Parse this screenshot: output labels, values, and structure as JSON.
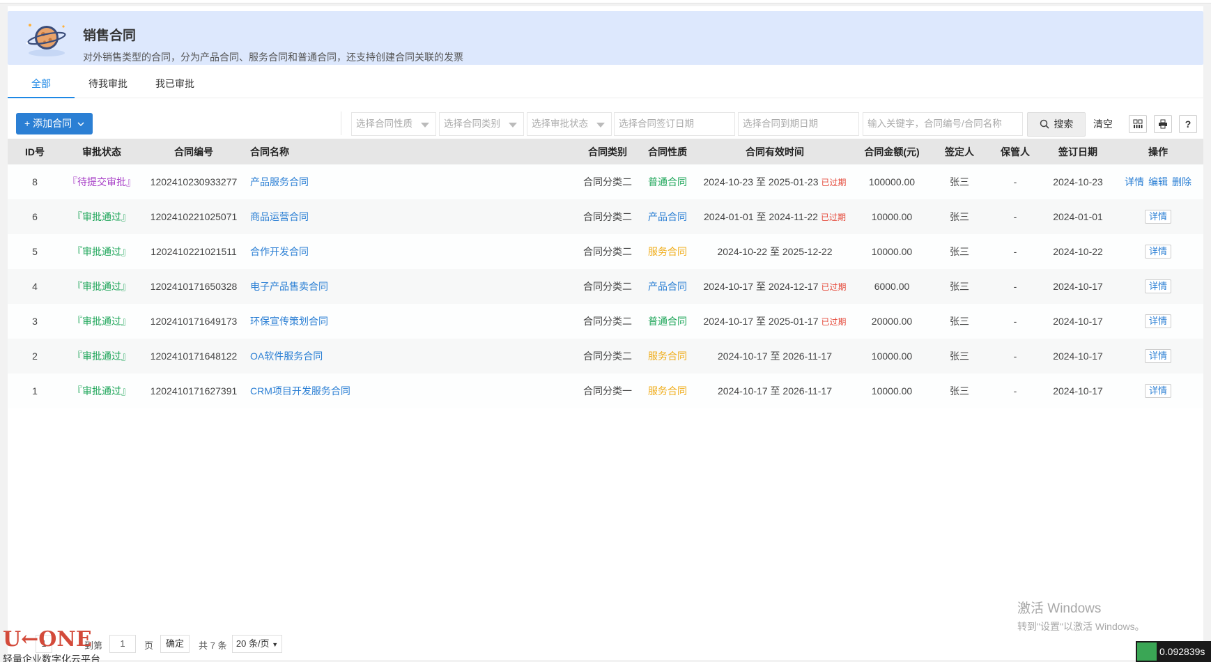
{
  "banner": {
    "title": "销售合同",
    "description": "对外销售类型的合同，分为产品合同、服务合同和普通合同，还支持创建合同关联的发票"
  },
  "tabs": [
    "全部",
    "待我审批",
    "我已审批"
  ],
  "toolbar": {
    "add_label": "+ 添加合同",
    "nature_placeholder": "选择合同性质",
    "category_placeholder": "选择合同类别",
    "status_placeholder": "选择审批状态",
    "sign_date_placeholder": "选择合同签订日期",
    "expire_date_placeholder": "选择合同到期日期",
    "keyword_placeholder": "输入关键字，合同编号/合同名称",
    "search_label": "搜索",
    "clear_label": "清空",
    "help_label": "?"
  },
  "table": {
    "headers": [
      "ID号",
      "审批状态",
      "合同编号",
      "合同名称",
      "合同类别",
      "合同性质",
      "合同有效时间",
      "合同金额(元)",
      "签定人",
      "保管人",
      "签订日期",
      "操作"
    ],
    "rows": [
      {
        "id": "8",
        "status": "『待提交审批』",
        "status_type": "pending",
        "code": "1202410230933277",
        "name": "产品服务合同",
        "category": "合同分类二",
        "nature": "普通合同",
        "nature_type": "normal",
        "period": "2024-10-23 至 2025-01-23",
        "expired": "已过期",
        "amount": "100000.00",
        "signer": "张三",
        "keeper": "-",
        "sign_date": "2024-10-23",
        "ops": [
          "详情",
          "编辑",
          "删除"
        ]
      },
      {
        "id": "6",
        "status": "『审批通过』",
        "status_type": "pass",
        "code": "1202410221025071",
        "name": "商品运营合同",
        "category": "合同分类二",
        "nature": "产品合同",
        "nature_type": "product",
        "period": "2024-01-01 至 2024-11-22",
        "expired": "已过期",
        "amount": "10000.00",
        "signer": "张三",
        "keeper": "-",
        "sign_date": "2024-01-01",
        "ops": [
          "详情"
        ]
      },
      {
        "id": "5",
        "status": "『审批通过』",
        "status_type": "pass",
        "code": "1202410221021511",
        "name": "合作开发合同",
        "category": "合同分类二",
        "nature": "服务合同",
        "nature_type": "service",
        "period": "2024-10-22 至 2025-12-22",
        "expired": "",
        "amount": "10000.00",
        "signer": "张三",
        "keeper": "-",
        "sign_date": "2024-10-22",
        "ops": [
          "详情"
        ]
      },
      {
        "id": "4",
        "status": "『审批通过』",
        "status_type": "pass",
        "code": "1202410171650328",
        "name": "电子产品售卖合同",
        "category": "合同分类二",
        "nature": "产品合同",
        "nature_type": "product",
        "period": "2024-10-17 至 2024-12-17",
        "expired": "已过期",
        "amount": "6000.00",
        "signer": "张三",
        "keeper": "-",
        "sign_date": "2024-10-17",
        "ops": [
          "详情"
        ]
      },
      {
        "id": "3",
        "status": "『审批通过』",
        "status_type": "pass",
        "code": "1202410171649173",
        "name": "环保宣传策划合同",
        "category": "合同分类二",
        "nature": "普通合同",
        "nature_type": "normal",
        "period": "2024-10-17 至 2025-01-17",
        "expired": "已过期",
        "amount": "20000.00",
        "signer": "张三",
        "keeper": "-",
        "sign_date": "2024-10-17",
        "ops": [
          "详情"
        ]
      },
      {
        "id": "2",
        "status": "『审批通过』",
        "status_type": "pass",
        "code": "1202410171648122",
        "name": "OA软件服务合同",
        "category": "合同分类二",
        "nature": "服务合同",
        "nature_type": "service",
        "period": "2024-10-17 至 2026-11-17",
        "expired": "",
        "amount": "10000.00",
        "signer": "张三",
        "keeper": "-",
        "sign_date": "2024-10-17",
        "ops": [
          "详情"
        ]
      },
      {
        "id": "1",
        "status": "『审批通过』",
        "status_type": "pass",
        "code": "1202410171627391",
        "name": "CRM项目开发服务合同",
        "category": "合同分类一",
        "nature": "服务合同",
        "nature_type": "service",
        "period": "2024-10-17 至 2026-11-17",
        "expired": "",
        "amount": "10000.00",
        "signer": "张三",
        "keeper": "-",
        "sign_date": "2024-10-17",
        "ops": [
          "详情"
        ]
      }
    ]
  },
  "pager": {
    "current": "1",
    "goto_label": "到第",
    "goto_value": "1",
    "page_unit": "页",
    "confirm_label": "确定",
    "total_label": "共 7 条",
    "page_size": "20 条/页"
  },
  "watermark": {
    "line1": "激活 Windows",
    "line2": "转到\"设置\"以激活 Windows。"
  },
  "corner_timer": "0.092839s",
  "brand": {
    "logo_text": "U←ONE",
    "tagline": "轻量企业数字化云平台"
  },
  "colors": {
    "accent": "#2b7fd4",
    "banner_bg": "#dde8fd",
    "pending": "#a83fc7",
    "pass": "#1fa65a",
    "service": "#f0ad1b",
    "expired": "#e54b3c"
  }
}
